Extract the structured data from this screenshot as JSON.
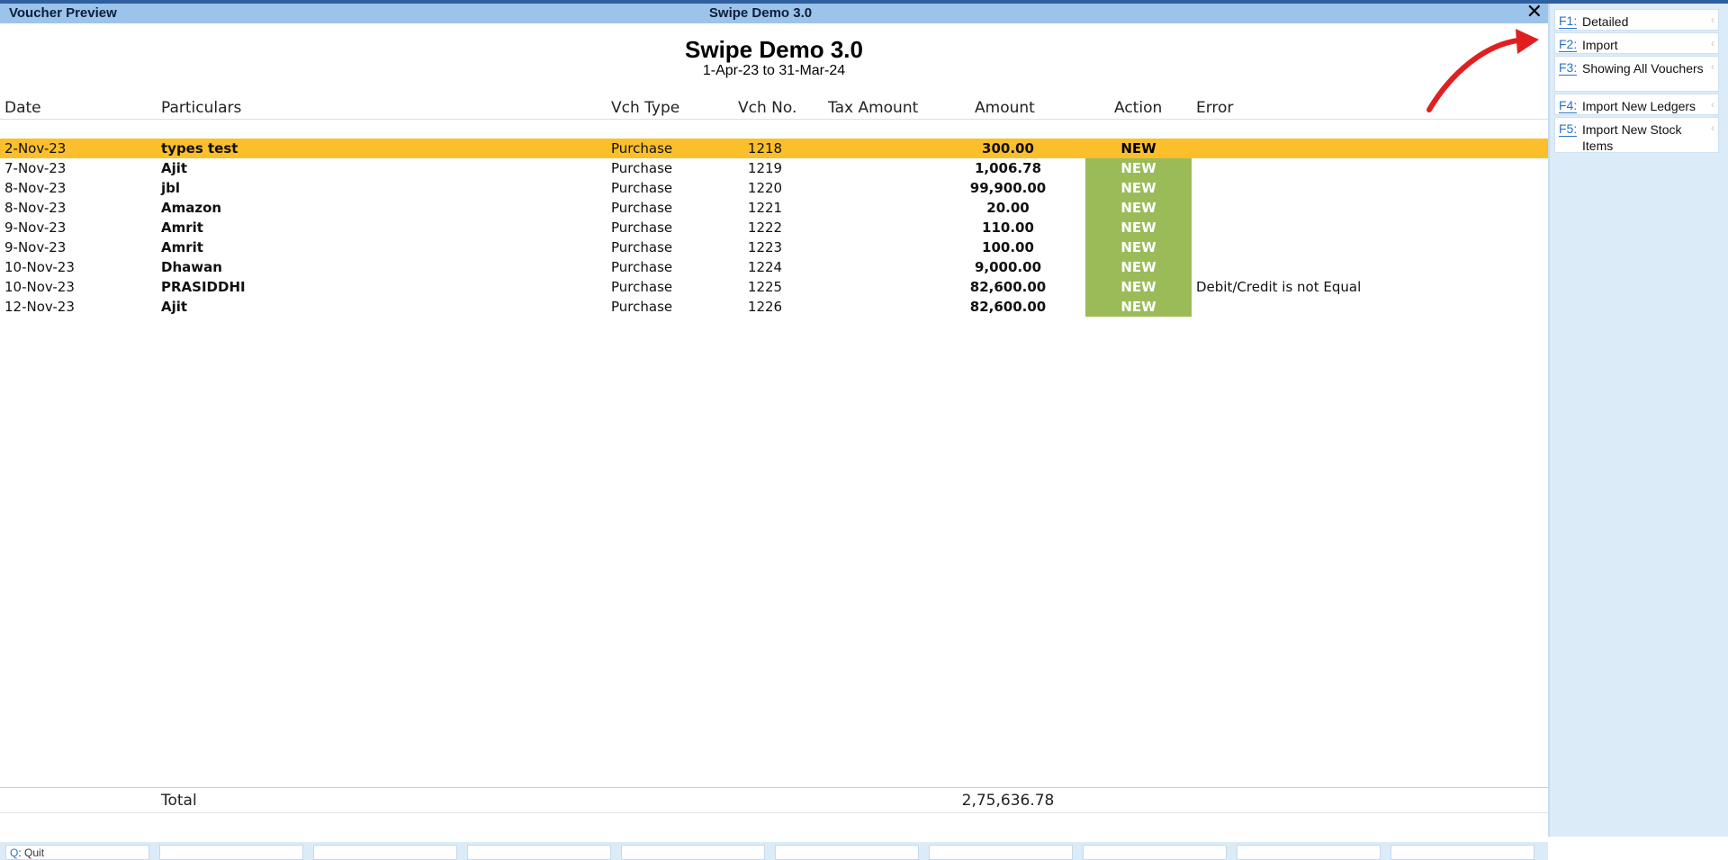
{
  "window": {
    "title_left": "Voucher Preview",
    "title_center": "Swipe Demo 3.0",
    "close_glyph": "✕"
  },
  "report": {
    "company": "Swipe Demo 3.0",
    "period": "1-Apr-23 to 31-Mar-24"
  },
  "columns": {
    "date": "Date",
    "particulars": "Particulars",
    "vch_type": "Vch Type",
    "vch_no": "Vch No.",
    "tax_amount": "Tax Amount",
    "amount": "Amount",
    "action": "Action",
    "error": "Error"
  },
  "rows": [
    {
      "date": "2-Nov-23",
      "particulars": "types test",
      "vch_type": "Purchase",
      "vch_no": "1218",
      "amount": "300.00",
      "action": "NEW",
      "error": ""
    },
    {
      "date": "7-Nov-23",
      "particulars": "Ajit",
      "vch_type": "Purchase",
      "vch_no": "1219",
      "amount": "1,006.78",
      "action": "NEW",
      "error": ""
    },
    {
      "date": "8-Nov-23",
      "particulars": "jbl",
      "vch_type": "Purchase",
      "vch_no": "1220",
      "amount": "99,900.00",
      "action": "NEW",
      "error": ""
    },
    {
      "date": "8-Nov-23",
      "particulars": "Amazon",
      "vch_type": "Purchase",
      "vch_no": "1221",
      "amount": "20.00",
      "action": "NEW",
      "error": ""
    },
    {
      "date": "9-Nov-23",
      "particulars": "Amrit",
      "vch_type": "Purchase",
      "vch_no": "1222",
      "amount": "110.00",
      "action": "NEW",
      "error": ""
    },
    {
      "date": "9-Nov-23",
      "particulars": "Amrit",
      "vch_type": "Purchase",
      "vch_no": "1223",
      "amount": "100.00",
      "action": "NEW",
      "error": ""
    },
    {
      "date": "10-Nov-23",
      "particulars": "Dhawan",
      "vch_type": "Purchase",
      "vch_no": "1224",
      "amount": "9,000.00",
      "action": "NEW",
      "error": ""
    },
    {
      "date": "10-Nov-23",
      "particulars": "PRASIDDHI",
      "vch_type": "Purchase",
      "vch_no": "1225",
      "amount": "82,600.00",
      "action": "NEW",
      "error": "Debit/Credit is not Equal"
    },
    {
      "date": "12-Nov-23",
      "particulars": "Ajit",
      "vch_type": "Purchase",
      "vch_no": "1226",
      "amount": "82,600.00",
      "action": "NEW",
      "error": ""
    }
  ],
  "total": {
    "label": "Total",
    "amount": "2,75,636.78"
  },
  "bottom_buttons": [
    {
      "key": "Q",
      "label": "Quit"
    }
  ],
  "sidebar": {
    "buttons": [
      {
        "key": "F1:",
        "label": "Detailed"
      },
      {
        "key": "F2:",
        "label": "Import"
      },
      {
        "key": "F3:",
        "label": "Showing All Vouchers"
      },
      {
        "key": "F4:",
        "label": "Import New Ledgers"
      },
      {
        "key": "F5:",
        "label": "Import New Stock Items"
      }
    ]
  },
  "colors": {
    "selected_row": "#fbbf2c",
    "action_badge": "#9bbb59",
    "titlebar": "#9cc3ea",
    "sidebar": "#dcebf8",
    "annotation_arrow": "#e02020"
  }
}
